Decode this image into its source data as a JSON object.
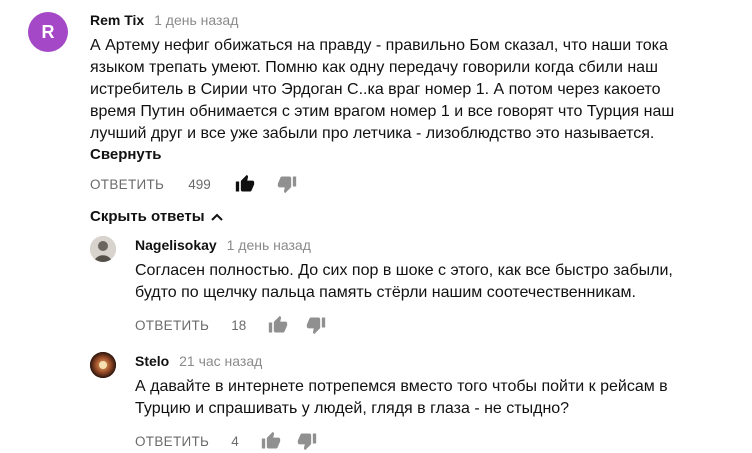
{
  "colors": {
    "avatar_r": "#a448c8",
    "muted": "#6b6b6b",
    "text": "#111111"
  },
  "top_comment": {
    "avatar_letter": "R",
    "author": "Rem Tix",
    "time": "1 день назад",
    "lines": [
      "А Артему нефиг обижаться на правду - правильно Бом сказал, что наши тока",
      "языком трепать умеют. Помню как одну передачу говорили когда сбили наш",
      "истребитель в Сирии что Эрдоган С..ка враг номер 1. А потом через какоето",
      "время Путин обнимается с этим врагом номер 1 и все говорят что Турция наш",
      "лучший друг и все уже забыли про летчика - лизоблюдство это называется."
    ],
    "collapse_label": "Свернуть",
    "reply_label": "ОТВЕТИТЬ",
    "likes": "499"
  },
  "toggle_replies_label": "Скрыть ответы",
  "replies": [
    {
      "author": "Nagelisokay",
      "time": "1 день назад",
      "lines": [
        "Согласен полностью. До сих пор в шоке с этого, как все быстро забыли,",
        "будто по щелчку пальца память стёрли нашим соотечественникам."
      ],
      "reply_label": "ОТВЕТИТЬ",
      "likes": "18"
    },
    {
      "author": "Stelo",
      "time": "21 час назад",
      "lines": [
        "А давайте в интернете потрепемся вместо того чтобы пойти к рейсам в",
        "Турцию и спрашивать у людей, глядя в глаза - не стыдно?"
      ],
      "reply_label": "ОТВЕТИТЬ",
      "likes": "4"
    }
  ]
}
